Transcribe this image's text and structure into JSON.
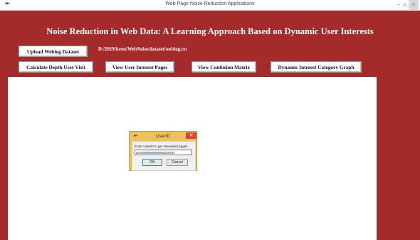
{
  "window": {
    "title": "Web Page Noise Reduction Applications",
    "app_icon": "feather-icon",
    "minimize": "–",
    "maximize": "▫",
    "close": "✕"
  },
  "heading": "Noise Reduction in Web Data: A Learning Approach Based on Dynamic User Interests",
  "buttons": {
    "upload": "Upload Weblog Dataset",
    "depth": "Calculate Depth User Visit",
    "interest_pages": "View User Interest Pages",
    "confusion": "View Confusion Matrix",
    "category_graph": "Dynamic Interest Category Graph"
  },
  "dataset_path": "D:/2019/krest/WebNoise/dataset/weblog.txt",
  "dialog": {
    "title": "UserID",
    "close": "✕",
    "prompt": "Enter UserID to get interested pages",
    "value": "anon000000000000029757",
    "ok": "OK",
    "cancel": "Cancel"
  },
  "colors": {
    "background": "#a52a2a",
    "dialog_frame": "#f0c05a"
  }
}
